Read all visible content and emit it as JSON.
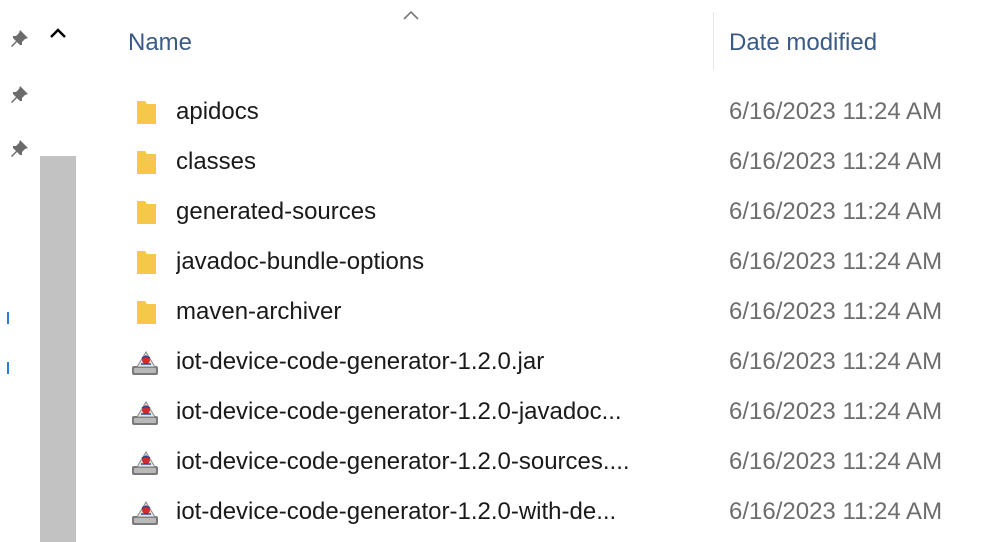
{
  "header": {
    "name_label": "Name",
    "date_label": "Date modified"
  },
  "icons": {
    "folder_color": "#f5c84c",
    "jar_icon": "java-jar-icon",
    "pin_icon": "pin-icon"
  },
  "files": [
    {
      "name": "apidocs",
      "date": "6/16/2023 11:24 AM",
      "type": "folder"
    },
    {
      "name": "classes",
      "date": "6/16/2023 11:24 AM",
      "type": "folder"
    },
    {
      "name": "generated-sources",
      "date": "6/16/2023 11:24 AM",
      "type": "folder"
    },
    {
      "name": "javadoc-bundle-options",
      "date": "6/16/2023 11:24 AM",
      "type": "folder"
    },
    {
      "name": "maven-archiver",
      "date": "6/16/2023 11:24 AM",
      "type": "folder"
    },
    {
      "name": "iot-device-code-generator-1.2.0.jar",
      "date": "6/16/2023 11:24 AM",
      "type": "jar"
    },
    {
      "name": "iot-device-code-generator-1.2.0-javadoc...",
      "date": "6/16/2023 11:24 AM",
      "type": "jar"
    },
    {
      "name": "iot-device-code-generator-1.2.0-sources....",
      "date": "6/16/2023 11:24 AM",
      "type": "jar"
    },
    {
      "name": "iot-device-code-generator-1.2.0-with-de...",
      "date": "6/16/2023 11:24 AM",
      "type": "jar"
    }
  ]
}
